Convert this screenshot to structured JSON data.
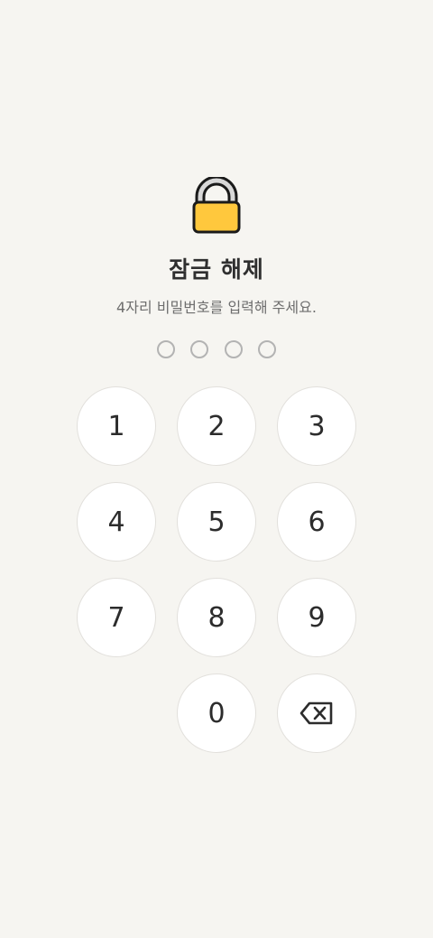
{
  "lock_screen": {
    "icon": "padlock-icon",
    "title": "잠금 해제",
    "subtitle": "4자리 비밀번호를 입력해 주세요.",
    "pin_length": 4,
    "pin_entered": 0
  },
  "keypad": {
    "keys": [
      "1",
      "2",
      "3",
      "4",
      "5",
      "6",
      "7",
      "8",
      "9",
      "0"
    ],
    "backspace_icon": "backspace-icon"
  },
  "colors": {
    "background": "#f6f5f1",
    "lock_body": "#ffc83d",
    "dot_outline": "#b3b3b3"
  }
}
